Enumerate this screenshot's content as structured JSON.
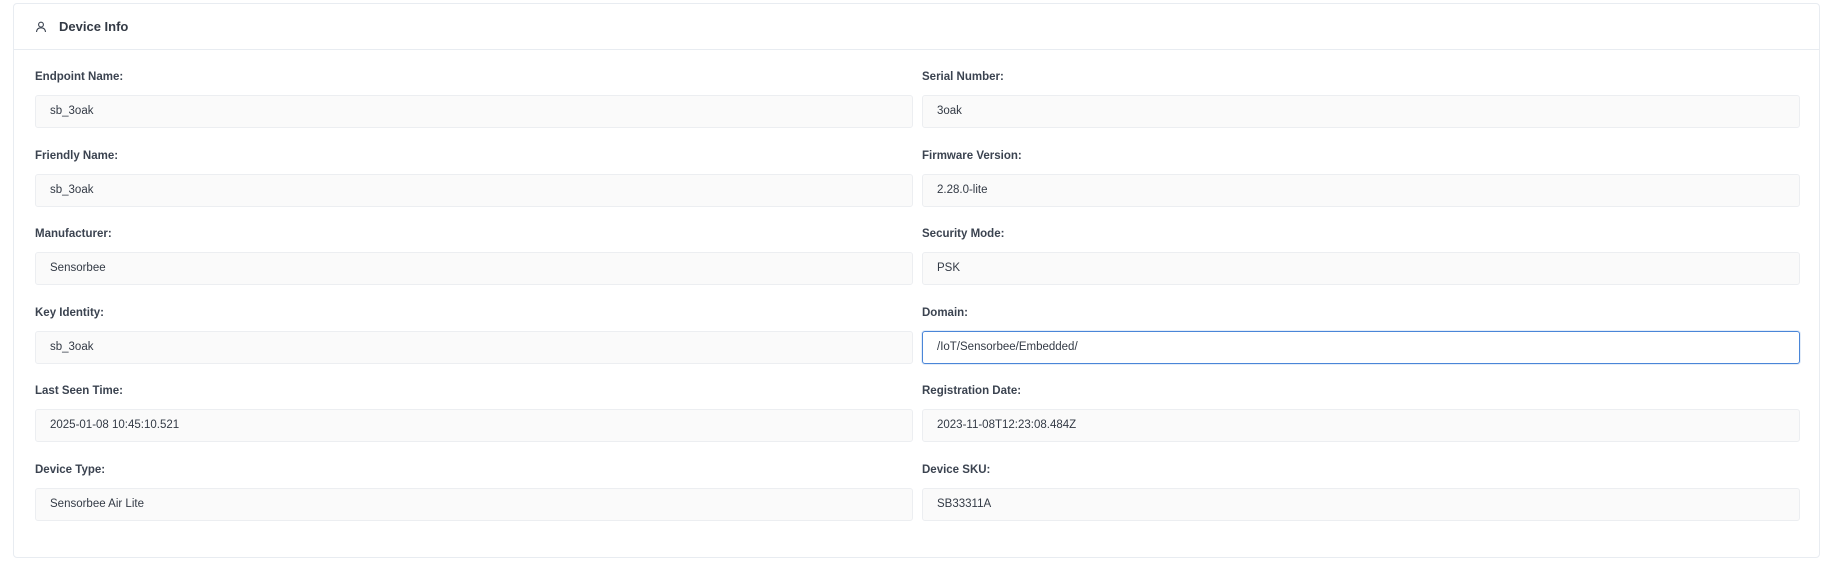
{
  "header": {
    "title": "Device Info",
    "icon": "user-icon"
  },
  "fields": [
    {
      "label": "Endpoint Name:",
      "value": "sb_3oak"
    },
    {
      "label": "Serial Number:",
      "value": "3oak"
    },
    {
      "label": "Friendly Name:",
      "value": "sb_3oak"
    },
    {
      "label": "Firmware Version:",
      "value": "2.28.0-lite"
    },
    {
      "label": "Manufacturer:",
      "value": "Sensorbee"
    },
    {
      "label": "Security Mode:",
      "value": "PSK"
    },
    {
      "label": "Key Identity:",
      "value": "sb_3oak"
    },
    {
      "label": "Domain:",
      "value": "/IoT/Sensorbee/Embedded/"
    },
    {
      "label": "Last Seen Time:",
      "value": "2025-01-08 10:45:10.521"
    },
    {
      "label": "Registration Date:",
      "value": "2023-11-08T12:23:08.484Z"
    },
    {
      "label": "Device Type:",
      "value": "Sensorbee Air Lite"
    },
    {
      "label": "Device SKU:",
      "value": "SB33311A"
    }
  ],
  "colors": {
    "focus_border": "#4a86d8",
    "field_background": "#fafafa",
    "border": "#e8ecf1"
  }
}
